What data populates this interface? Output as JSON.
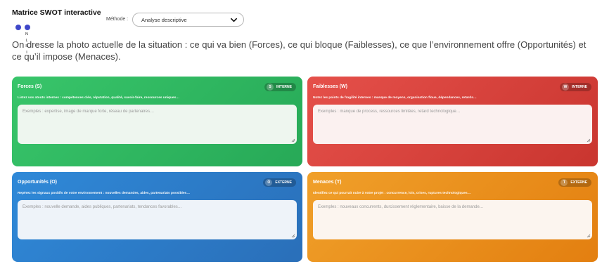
{
  "header": {
    "title": "Matrice SWOT interactive",
    "method_label": "Méthode :",
    "method_value": "Analyse descriptive",
    "vertical_letters": [
      "N",
      "L",
      "S",
      "I"
    ]
  },
  "intro": "On dresse la photo actuelle de la situation : ce qui va bien (Forces), ce qui bloque (Faiblesses), ce que l’environnement offre (Opportunités) et ce qu’il impose (Menaces).",
  "cards": {
    "s": {
      "title": "Forces (S)",
      "badge_letter": "S",
      "badge_label": "INTERNE",
      "description": "Listez vos atouts internes : compétences clés, réputation, qualité, savoir-faire, ressources uniques…",
      "placeholder": "Exemples : expertise, image de marque forte, réseau de partenaires…"
    },
    "w": {
      "title": "Faiblesses (W)",
      "badge_letter": "W",
      "badge_label": "INTERNE",
      "description": "Notez les points de fragilité internes : manque de moyens, organisation floue, dépendances, retards…",
      "placeholder": "Exemples : manque de process, ressources limitées, retard technologique…"
    },
    "o": {
      "title": "Opportunités (O)",
      "badge_letter": "O",
      "badge_label": "EXTERNE",
      "description": "Repérez les signaux positifs de votre environnement : nouvelles demandes, aides, partenariats possibles…",
      "placeholder": "Exemples : nouvelle demande, aides publiques, partenariats, tendances favorables…"
    },
    "t": {
      "title": "Menaces (T)",
      "badge_letter": "T",
      "badge_label": "EXTERNE",
      "description": "Identifiez ce qui pourrait nuire à votre projet : concurrence, lois, crises, ruptures technologiques…",
      "placeholder": "Exemples : nouveaux concurrents, durcissement réglementaire, baisse de la demande…"
    }
  },
  "colors": {
    "forces": "#2fb961",
    "faiblesses": "#d9403a",
    "opportunites": "#2d7cc9",
    "menaces": "#ea8f1d",
    "toggle": "#3f47c9"
  }
}
